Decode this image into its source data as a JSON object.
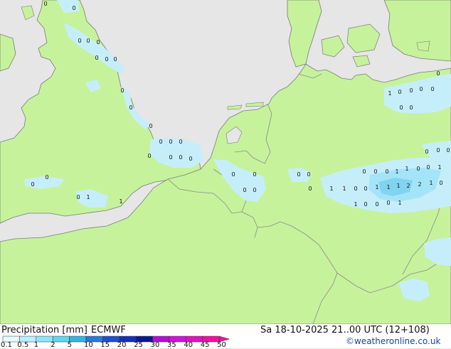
{
  "legend": {
    "title": "Precipitation [mm]",
    "model": "ECMWF",
    "ticks": [
      "0.1",
      "0.5",
      "1",
      "2",
      "5",
      "10",
      "15",
      "20",
      "25",
      "30",
      "35",
      "40",
      "45",
      "50"
    ],
    "colors": [
      "#e6fbff",
      "#b8f1ff",
      "#8ce6f8",
      "#5ed8ef",
      "#3ab2e0",
      "#2a78d8",
      "#1e4fd0",
      "#1430b8",
      "#0d178f",
      "#b60fd0",
      "#d80fdb",
      "#e70fc0",
      "#f00fa3"
    ]
  },
  "valid_time": "Sa 18-10-2025 21..00 UTC (12+108)",
  "credit": "©weatheronline.co.uk",
  "map": {
    "colors": {
      "land": "#c6f29c",
      "sea": "#e6e6e6",
      "border": "#8a8a8a",
      "coast": "#7a7a7a",
      "precip_light": "#c6eefa",
      "precip_mid": "#a4e4f8",
      "precip_strong": "#80d4f0"
    },
    "values": [
      "0",
      "0",
      "0",
      "0",
      "0",
      "0",
      "0",
      "0",
      "0",
      "0",
      "0",
      "0",
      "0",
      "0",
      "0",
      "0",
      "0",
      "0",
      "0",
      "0",
      "0",
      "1",
      "1",
      "0",
      "0",
      "0",
      "0",
      "0",
      "0",
      "0",
      "0",
      "0",
      "0",
      "1",
      "1",
      "0",
      "0",
      "1",
      "1",
      "1",
      "0",
      "0",
      "1",
      "1",
      "1",
      "2",
      "2",
      "1",
      "0",
      "1",
      "0",
      "0",
      "0",
      "1",
      "1",
      "0",
      "0",
      "0",
      "0",
      "0",
      "0",
      "0",
      "0",
      "0",
      "0"
    ]
  }
}
